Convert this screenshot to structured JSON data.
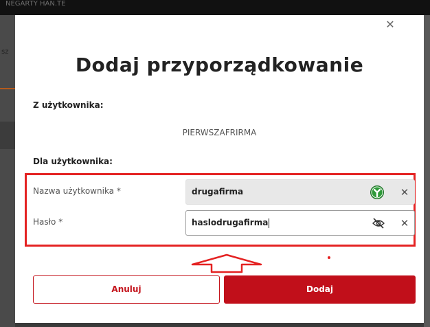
{
  "background": {
    "top_strip_text": "NEGARTY HAN.TE",
    "left_fragment": "sz"
  },
  "modal": {
    "close_icon": "close-icon",
    "title": "Dodaj przyporządkowanie",
    "from_label": "Z użytkownika:",
    "from_value": "PIERWSZAFRIRMA",
    "to_label": "Dla użytkownika:",
    "username": {
      "label": "Nazwa użytkownika *",
      "value": "drugafirma",
      "icon": "password-manager-icon",
      "clear_icon": "clear-icon"
    },
    "password": {
      "label": "Hasło *",
      "value": "haslodrugafirma",
      "icon": "eye-slash-icon",
      "clear_icon": "clear-icon"
    },
    "buttons": {
      "cancel": "Anuluj",
      "add": "Dodaj"
    }
  },
  "colors": {
    "brand_red": "#c10f1a",
    "highlight_red": "#e42222",
    "overlay": "#3a3a3a"
  }
}
